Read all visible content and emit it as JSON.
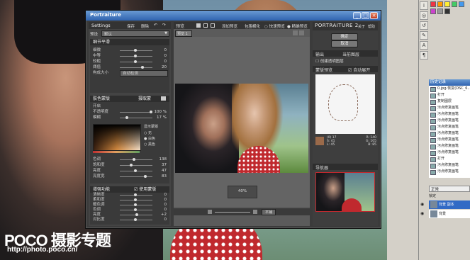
{
  "window": {
    "title": "Portraiture"
  },
  "left": {
    "settings_label": "Settings",
    "save_label": "保存",
    "delete_label": "删除",
    "preset_prefix": "预设",
    "preset_value": "默认",
    "detail": {
      "header": "细节平滑",
      "rows": [
        {
          "label": "细微",
          "value": "0"
        },
        {
          "label": "中等",
          "value": "0"
        },
        {
          "label": "较粗",
          "value": "0"
        },
        {
          "label": "阈值",
          "value": "20"
        }
      ],
      "size_label": "构成大小",
      "size_value": "自动检测"
    },
    "mask": {
      "header": "肤色蒙版",
      "mode": "摄取蒙",
      "rows": [
        {
          "label": "开启",
          "value": ""
        },
        {
          "label": "不透明度",
          "value": "100 %"
        },
        {
          "label": "模糊",
          "value": "17 %"
        }
      ],
      "show_mask": "显示蒙版",
      "opt_none": "无",
      "opt_white": "白色",
      "opt_black": "黑色",
      "sliders": [
        {
          "label": "色调",
          "value": "138"
        },
        {
          "label": "饱和度",
          "value": "37"
        },
        {
          "label": "亮度",
          "value": "47"
        },
        {
          "label": "亮度宽",
          "value": "83"
        }
      ]
    },
    "enhance": {
      "header": "增强功能",
      "use_mask": "使用蒙版",
      "rows": [
        {
          "label": "清晰度",
          "value": "0"
        },
        {
          "label": "柔和度",
          "value": "0"
        },
        {
          "label": "暖色调",
          "value": "0"
        },
        {
          "label": "色调",
          "value": "0"
        },
        {
          "label": "亮度",
          "value": "+2"
        },
        {
          "label": "对比度",
          "value": "0"
        }
      ]
    }
  },
  "middle": {
    "tab_preview": "预览",
    "add_preview": "添加预览",
    "original": "包围横化",
    "fast_preview": "快速预览",
    "precise_preview": "精确预览",
    "preview_tab": "预览 1",
    "zoom": "40%",
    "fit_label": "平铺"
  },
  "right": {
    "brand": "PORTRAITURE 2",
    "about": "关于",
    "help": "帮助",
    "ok": "确定",
    "cancel": "取消",
    "output_label": "输出",
    "output_value": "当前图层",
    "create_layer": "创建透明图层",
    "mask_preview": "蒙版预览",
    "auto_show": "自动展开",
    "color_stats": {
      "h": "H: 13",
      "s": "S: 41",
      "l": "L: 45",
      "r": "R: 140",
      "g": "G: 105",
      "b": "B: 85",
      "hex": "(0) 17"
    },
    "navigator": "导航器"
  },
  "ps": {
    "history_title": "历史记录",
    "history_items": [
      "0.jpg-恢复(DSC_6...",
      "打开",
      "复制图层",
      "污点修复画笔",
      "污点修复画笔",
      "污点修复画笔",
      "污点修复画笔",
      "污点修复画笔",
      "污点修复画笔",
      "污点修复画笔",
      "污点修复画笔",
      "打开",
      "污点修复画笔",
      "污点修复画笔",
      "污点修复画笔",
      "污点修复画笔"
    ],
    "blend_mode": "正常",
    "lock_label": "锁定",
    "layers": [
      {
        "name": "背景 副本"
      },
      {
        "name": "背景"
      }
    ]
  },
  "watermark": {
    "brand": "POCO 摄影专题",
    "url": "http://photo.poco.cn/"
  },
  "colors": {
    "titlebar": "#2f63b0",
    "panel": "#444444",
    "accent": "#c0292e"
  }
}
